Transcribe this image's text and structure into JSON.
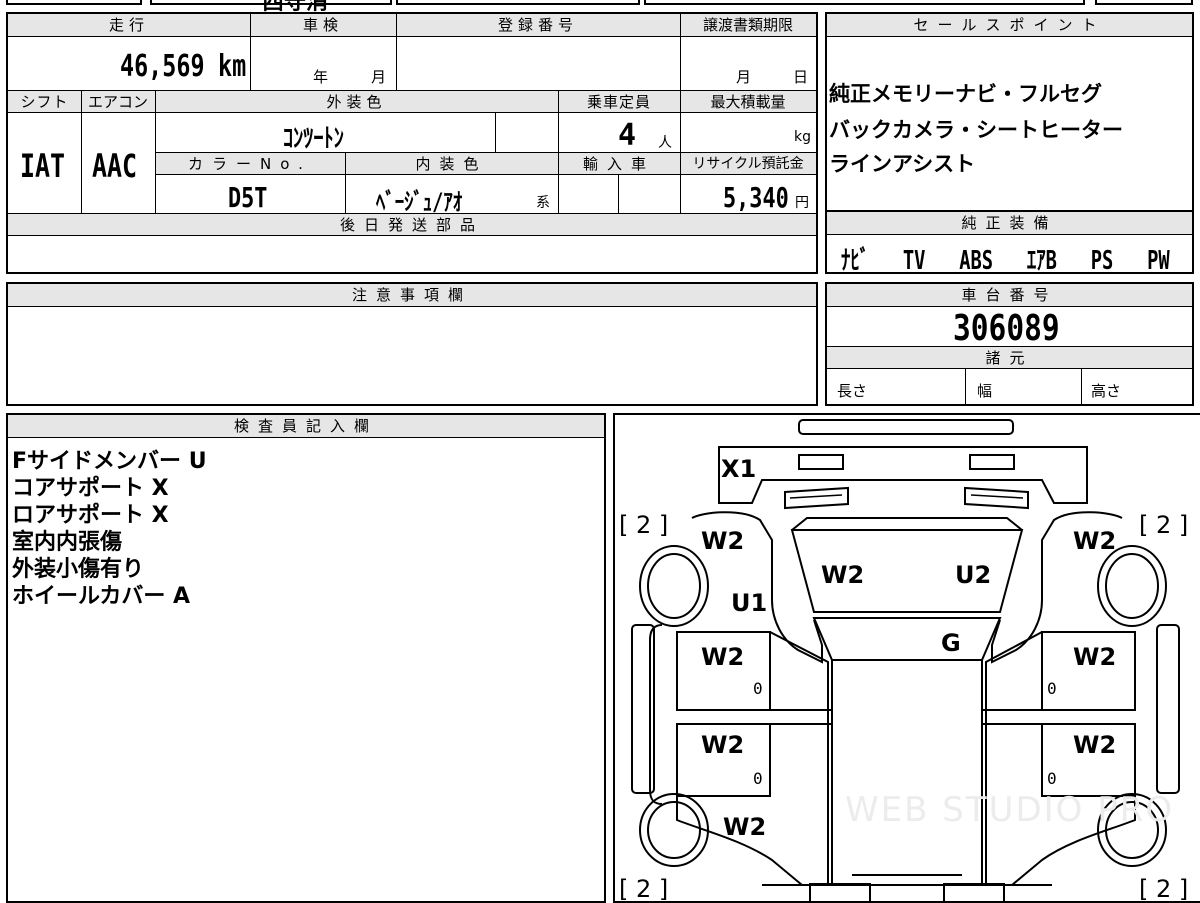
{
  "top_strip": {
    "partial_text": "西守消"
  },
  "vehicle": {
    "headers": {
      "mileage": "走行",
      "inspection": "車検",
      "registration": "登録番号",
      "transfer_deadline": "譲渡書類期限",
      "shift": "シフト",
      "aircon": "エアコン",
      "exterior_color": "外装色",
      "capacity": "乗車定員",
      "max_load": "最大積載量",
      "color_no": "カラーNo.",
      "interior_color": "内装色",
      "import": "輸入車",
      "recycle": "リサイクル預託金",
      "later_parts": "後日発送部品"
    },
    "mileage_value": "46,569",
    "mileage_unit": "km",
    "inspection_year_unit": "年",
    "inspection_month_unit": "月",
    "transfer_month_unit": "月",
    "transfer_day_unit": "日",
    "shift_value": "IAT",
    "aircon_value": "AAC",
    "exterior_color_value": "ｺﾝﾂｰﾄﾝ",
    "capacity_value": "4",
    "capacity_unit": "人",
    "max_load_unit": "kg",
    "color_no_value": "D5T",
    "interior_color_value": "ﾍﾞｰｼﾞｭ/ｱｵ",
    "interior_suffix": "系",
    "recycle_value": "5,340",
    "recycle_unit": "円"
  },
  "sales_points": {
    "header": "セールスポイント",
    "lines": [
      "純正メモリーナビ・フルセグ",
      "バックカメラ・シートヒーター",
      "ラインアシスト"
    ]
  },
  "genuine_equipment": {
    "header": "純正装備",
    "items": [
      "ﾅﾋﾞ",
      "TV",
      "ABS",
      "ｴｱB",
      "PS",
      "PW"
    ]
  },
  "notes": {
    "header": "注意事項欄"
  },
  "chassis": {
    "header": "車台番号",
    "value": "306089"
  },
  "specs": {
    "header": "諸元",
    "length": "長さ",
    "width": "幅",
    "height": "高さ"
  },
  "inspector": {
    "header": "検査員記入欄",
    "lines": [
      "Fサイドメンバー U",
      "コアサポート X",
      "ロアサポート X",
      "室内内張傷",
      "外装小傷有り",
      "ホイールカバー A"
    ]
  },
  "diagram": {
    "marks": {
      "front_bumper": "X1",
      "fl_wheel_bracket": "[ 2 ]",
      "fr_wheel_bracket": "[ 2 ]",
      "rl_wheel_bracket": "[ 2 ]",
      "rr_wheel_bracket": "[ 2 ]",
      "fl_fender": "W2",
      "fr_fender": "W2",
      "hood_left": "W2",
      "hood_right": "U2",
      "fl_apron": "U1",
      "windshield": "G",
      "fl_door": "W2",
      "fr_door": "W2",
      "rl_door": "W2",
      "rr_door": "W2",
      "rl_quarter": "W2",
      "door_zero_1": "0",
      "door_zero_2": "0",
      "door_zero_3": "0",
      "door_zero_4": "0"
    },
    "watermark": "WEB STUDIO PRO"
  }
}
